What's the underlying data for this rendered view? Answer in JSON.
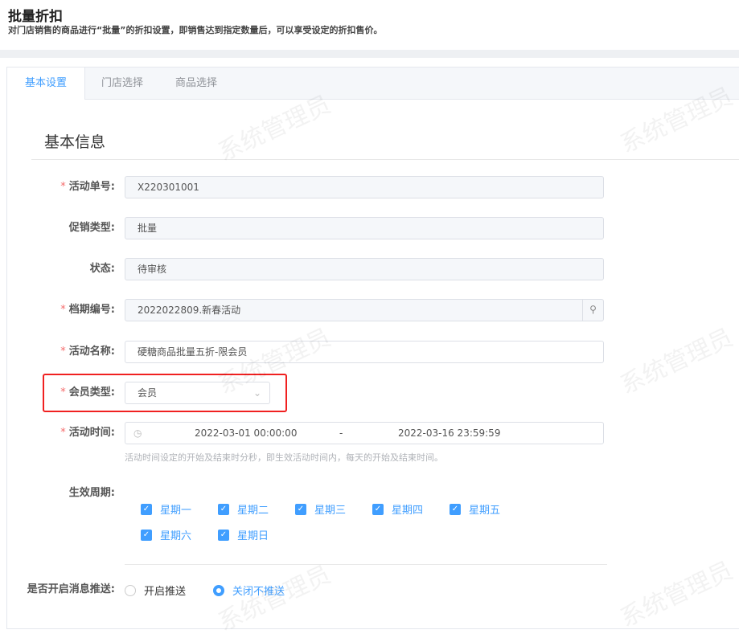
{
  "header": {
    "title": "批量折扣",
    "subtitle": "对门店销售的商品进行“批量”的折扣设置，即销售达到指定数量后，可以享受设定的折扣售价。"
  },
  "tabs": [
    {
      "label": "基本设置"
    },
    {
      "label": "门店选择"
    },
    {
      "label": "商品选择"
    }
  ],
  "section_title": "基本信息",
  "form": {
    "activity_no": {
      "label": "活动单号:",
      "value": "X220301001"
    },
    "promo_type": {
      "label": "促销类型:",
      "value": "批量"
    },
    "status": {
      "label": "状态:",
      "value": "待审核"
    },
    "schedule_no": {
      "label": "档期编号:",
      "value": "2022022809.新春活动"
    },
    "activity_name": {
      "label": "活动名称:",
      "value": "硬糖商品批量五折-限会员"
    },
    "member_type": {
      "label": "会员类型:",
      "value": "会员"
    },
    "activity_time": {
      "label": "活动时间:",
      "start": "2022-03-01 00:00:00",
      "sep": "-",
      "end": "2022-03-16 23:59:59",
      "hint": "活动时间设定的开始及结束时分秒，即生效活动时间内，每天的开始及结束时间。"
    },
    "cycle": {
      "label": "生效周期:",
      "days": [
        "星期一",
        "星期二",
        "星期三",
        "星期四",
        "星期五",
        "星期六",
        "星期日"
      ]
    },
    "push": {
      "label": "是否开启消息推送:",
      "options": [
        "开启推送",
        "关闭不推送"
      ],
      "selected": "关闭不推送"
    }
  },
  "watermark": "系统管理员",
  "accent": "#409eff"
}
